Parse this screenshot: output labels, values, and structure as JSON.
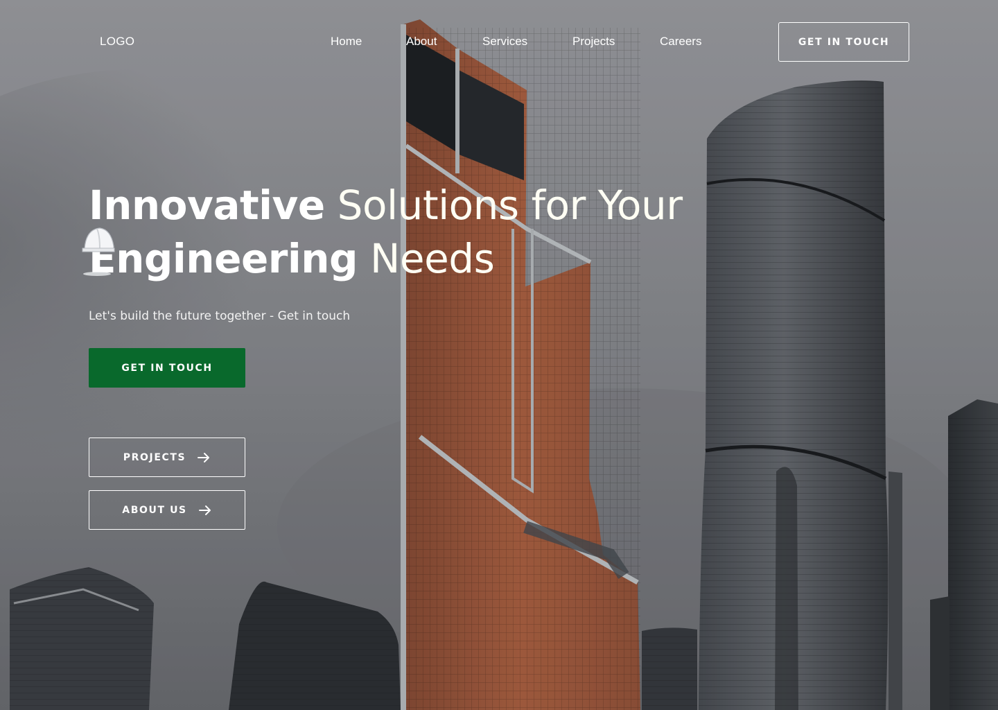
{
  "nav": {
    "logo": "LOGO",
    "links": [
      "Home",
      "About",
      "Services",
      "Projects",
      "Careers"
    ],
    "cta": "GET IN TOUCH"
  },
  "hero": {
    "headline": {
      "line1_bold": "Innovative",
      "line1_rest": " Solutions for Your",
      "line2_bold": "Engineering",
      "line2_rest": " Needs"
    },
    "subtitle": "Let's build the future together - Get in touch",
    "primary_button": "GET IN TOUCH",
    "projects_button": "PROJECTS",
    "about_button": "ABOUT US"
  },
  "colors": {
    "primary_green": "#09692c",
    "sky_gray": "#8f9196",
    "copper": "#b26545"
  },
  "icons": [
    "helmet-icon",
    "arrow-right-icon"
  ]
}
